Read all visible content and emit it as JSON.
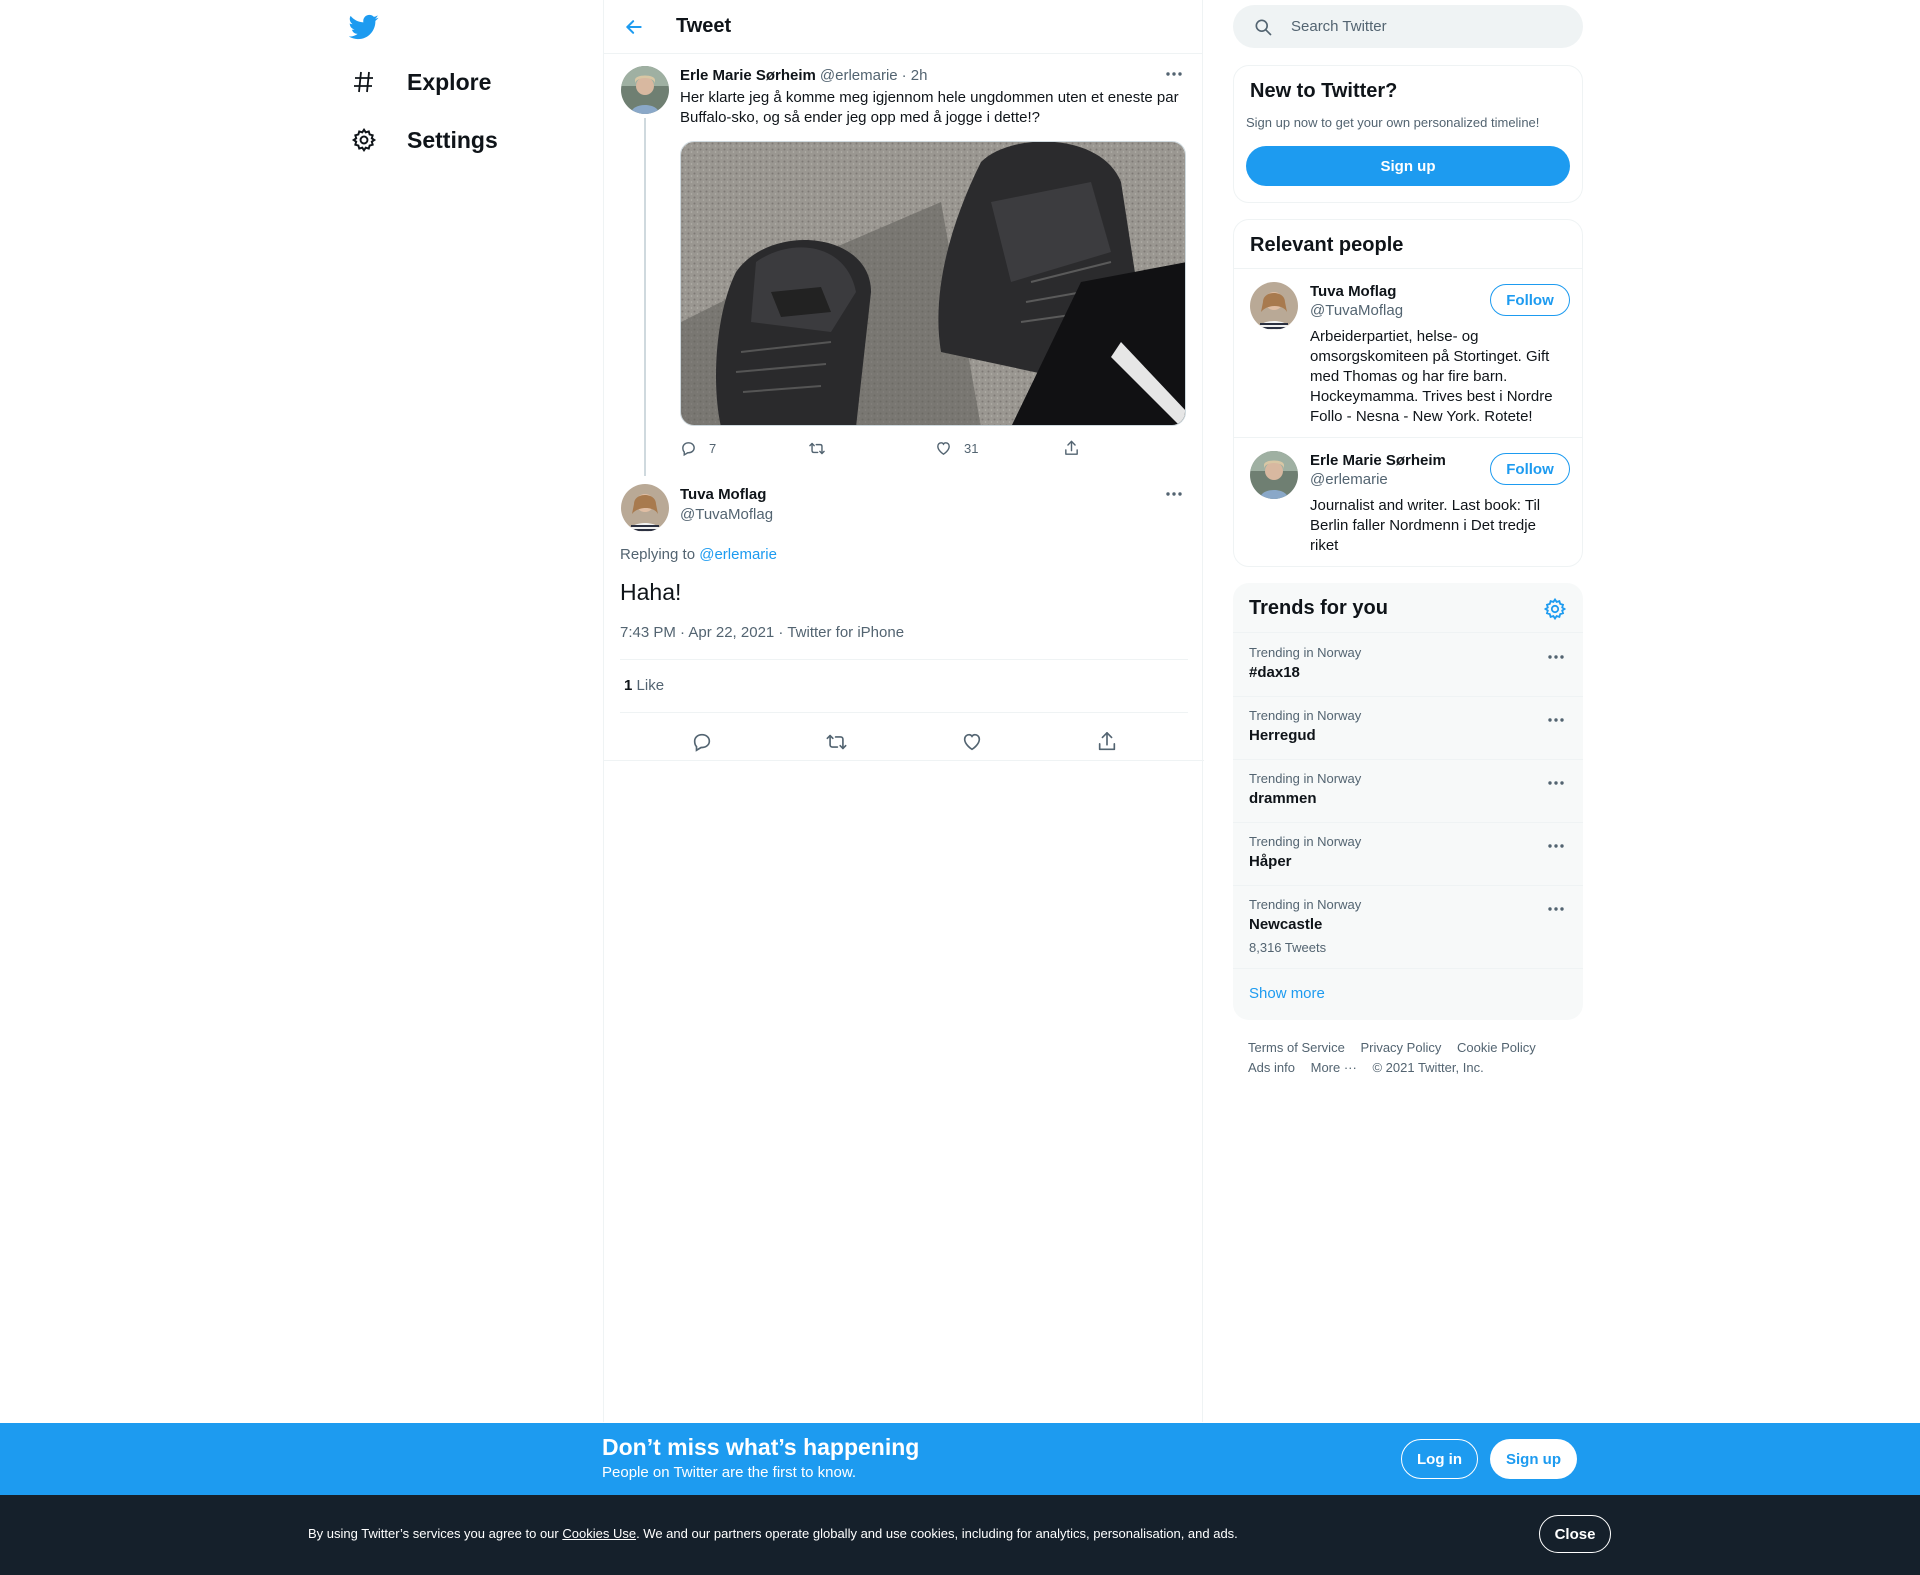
{
  "nav": {
    "logo_icon": "twitter-bird-icon",
    "items": [
      {
        "label": "Explore",
        "icon": "hashtag-icon"
      },
      {
        "label": "Settings",
        "icon": "gear-icon"
      }
    ]
  },
  "header": {
    "title": "Tweet",
    "back_icon": "arrow-left-icon"
  },
  "parent_tweet": {
    "author_name": "Erle Marie Sørheim",
    "author_handle": "@erlemarie",
    "time": "· 2h",
    "text": "Her klarte jeg å komme meg igjennom hele ungdommen uten et eneste par Buffalo-sko, og så ender jeg opp med å jogge i dette!?",
    "actions": {
      "replies": "7",
      "retweets": "",
      "likes": "31"
    }
  },
  "main_tweet": {
    "author_name": "Tuva Moflag",
    "author_handle": "@TuvaMoflag",
    "replying_prefix": "Replying to",
    "replying_to": "@erlemarie",
    "text": "Haha!",
    "meta": "7:43 PM · Apr 22, 2021 · Twitter for iPhone",
    "like_count": "1",
    "like_label": "Like"
  },
  "search": {
    "placeholder": "Search Twitter"
  },
  "new_to_twitter": {
    "title": "New to Twitter?",
    "subtitle": "Sign up now to get your own personalized timeline!",
    "button": "Sign up"
  },
  "relevant_people": {
    "title": "Relevant people",
    "people": [
      {
        "name": "Tuva Moflag",
        "handle": "@TuvaMoflag",
        "bio": "Arbeiderpartiet, helse- og omsorgskomiteen på Stortinget. Gift med Thomas og har fire barn. Hockeymamma. Trives best i Nordre Follo - Nesna - New York. Rotete!",
        "follow": "Follow"
      },
      {
        "name": "Erle Marie Sørheim",
        "handle": "@erlemarie",
        "bio": "Journalist and writer. Last book: Til Berlin faller Nordmenn i Det tredje riket",
        "follow": "Follow"
      }
    ]
  },
  "trends": {
    "title": "Trends for you",
    "items": [
      {
        "context": "Trending in Norway",
        "name": "#dax18",
        "count": ""
      },
      {
        "context": "Trending in Norway",
        "name": "Herregud",
        "count": ""
      },
      {
        "context": "Trending in Norway",
        "name": "drammen",
        "count": ""
      },
      {
        "context": "Trending in Norway",
        "name": "Håper",
        "count": ""
      },
      {
        "context": "Trending in Norway",
        "name": "Newcastle",
        "count": "8,316 Tweets"
      }
    ],
    "show_more": "Show more"
  },
  "footer": {
    "links": [
      "Terms of Service",
      "Privacy Policy",
      "Cookie Policy",
      "Ads info",
      "More ···"
    ],
    "copyright": "© 2021 Twitter, Inc."
  },
  "bottom_bar": {
    "title": "Don’t miss what’s happening",
    "subtitle": "People on Twitter are the first to know.",
    "login": "Log in",
    "signup": "Sign up"
  },
  "cookie_bar": {
    "text_before": "By using Twitter’s services you agree to our ",
    "link": "Cookies Use",
    "text_after": ". We and our partners operate globally and use cookies, including for analytics, personalisation, and ads.",
    "close": "Close"
  },
  "colors": {
    "accent": "#1d9bf0",
    "text": "#0f1419",
    "muted": "#536471",
    "border": "#eff3f4",
    "cookie_bg": "#15202b"
  }
}
